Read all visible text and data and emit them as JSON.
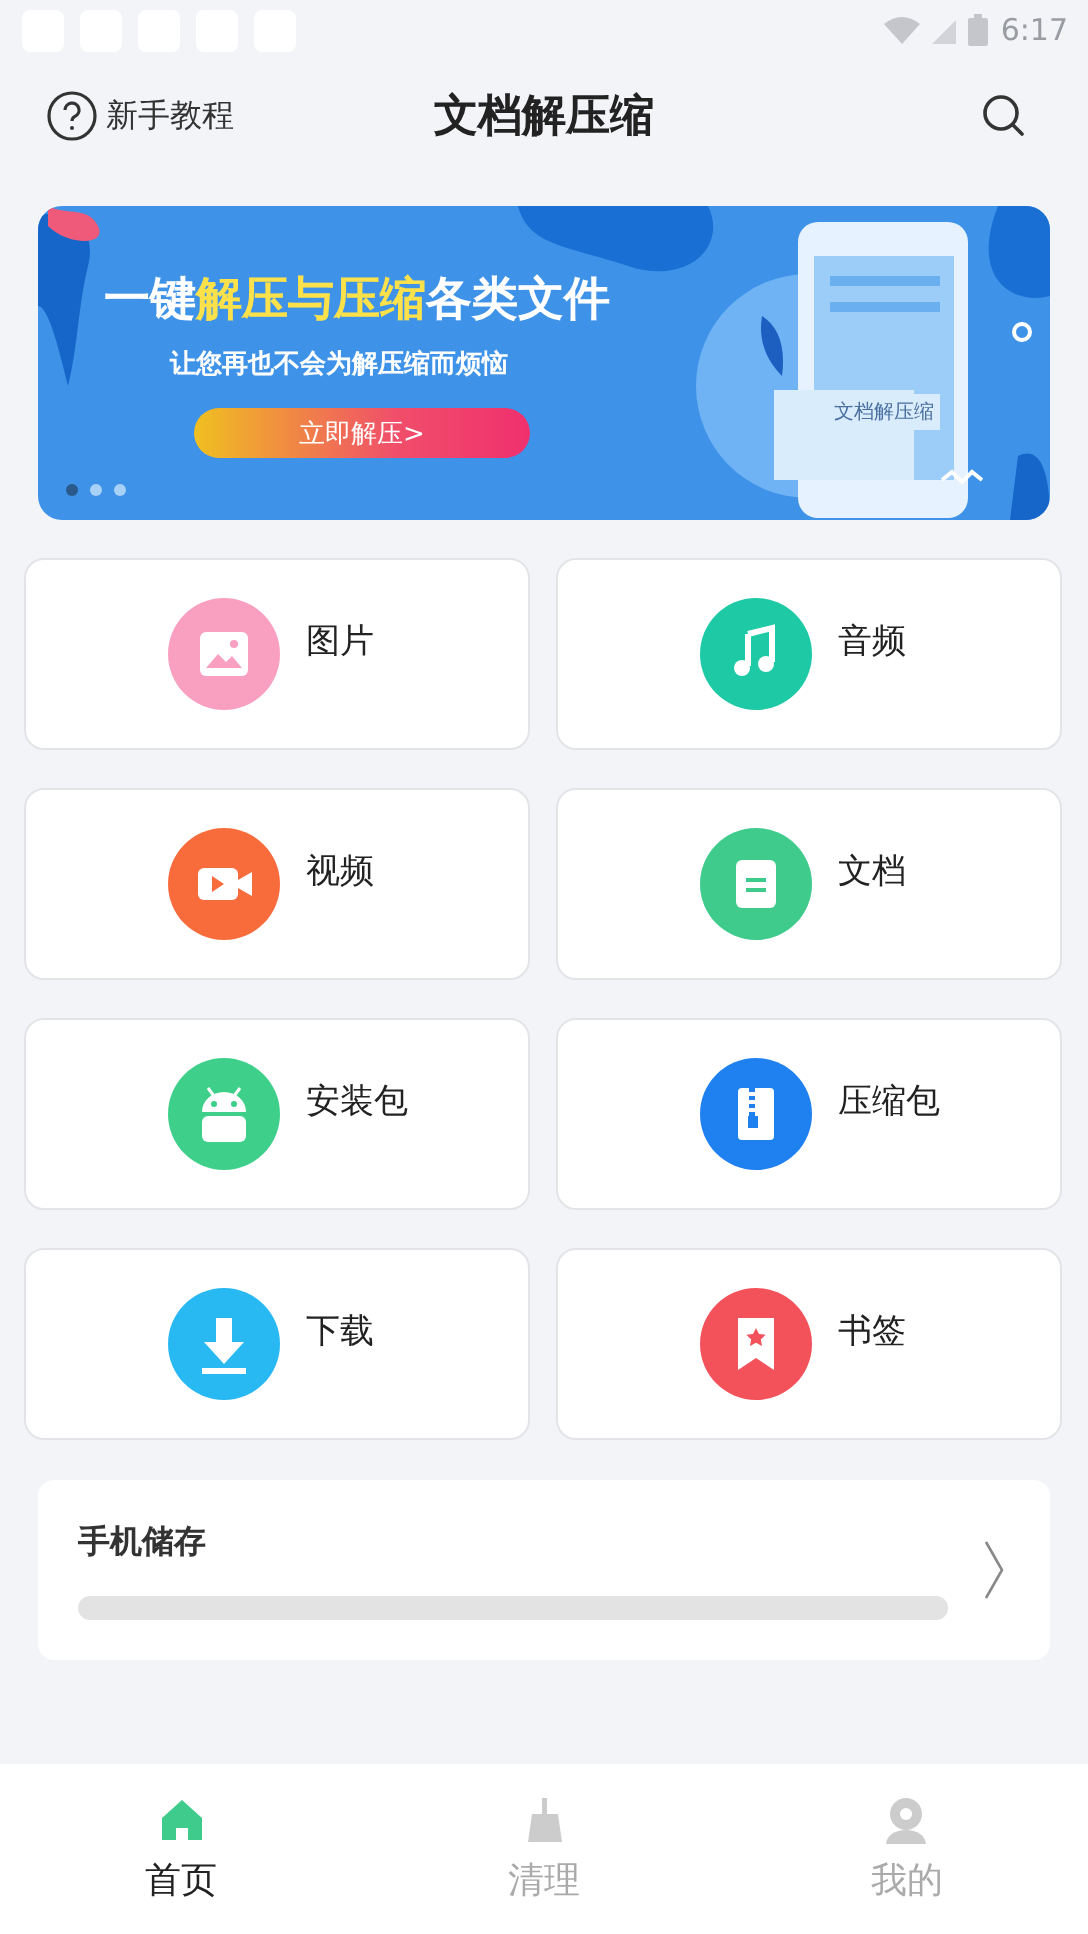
{
  "status_bar": {
    "time": "6:17"
  },
  "header": {
    "help_label": "新手教程",
    "title": "文档解压缩"
  },
  "banner": {
    "headline": [
      {
        "text": "一键",
        "highlight": false
      },
      {
        "text": "解压与压缩",
        "highlight": true
      },
      {
        "text": "各类文件",
        "highlight": false
      }
    ],
    "subtitle": "让您再也不会为解压缩而烦恼",
    "button": "立即解压>",
    "phone_text": "文档解压缩",
    "dots": [
      {
        "selected": true
      },
      {
        "selected": false
      },
      {
        "selected": false
      }
    ]
  },
  "categories": [
    {
      "label": "图片",
      "kind": "image",
      "color": "#f9a0c0"
    },
    {
      "label": "音频",
      "kind": "music",
      "color": "#1ec9a6"
    },
    {
      "label": "视频",
      "kind": "video",
      "color": "#f86c3c"
    },
    {
      "label": "文档",
      "kind": "doc",
      "color": "#3ecb8c"
    },
    {
      "label": "安装包",
      "kind": "android",
      "color": "#3ecf8a"
    },
    {
      "label": "压缩包",
      "kind": "zip",
      "color": "#1f80f0"
    },
    {
      "label": "下载",
      "kind": "download",
      "color": "#28b9f2"
    },
    {
      "label": "书签",
      "kind": "bookmark",
      "color": "#f4525b"
    }
  ],
  "storage": {
    "title": "手机储存",
    "level": 0
  },
  "bottom_nav": [
    {
      "label": "首页",
      "kind": "home",
      "selected": true
    },
    {
      "label": "清理",
      "kind": "broom",
      "selected": false
    },
    {
      "label": "我的",
      "kind": "person",
      "selected": false
    }
  ]
}
